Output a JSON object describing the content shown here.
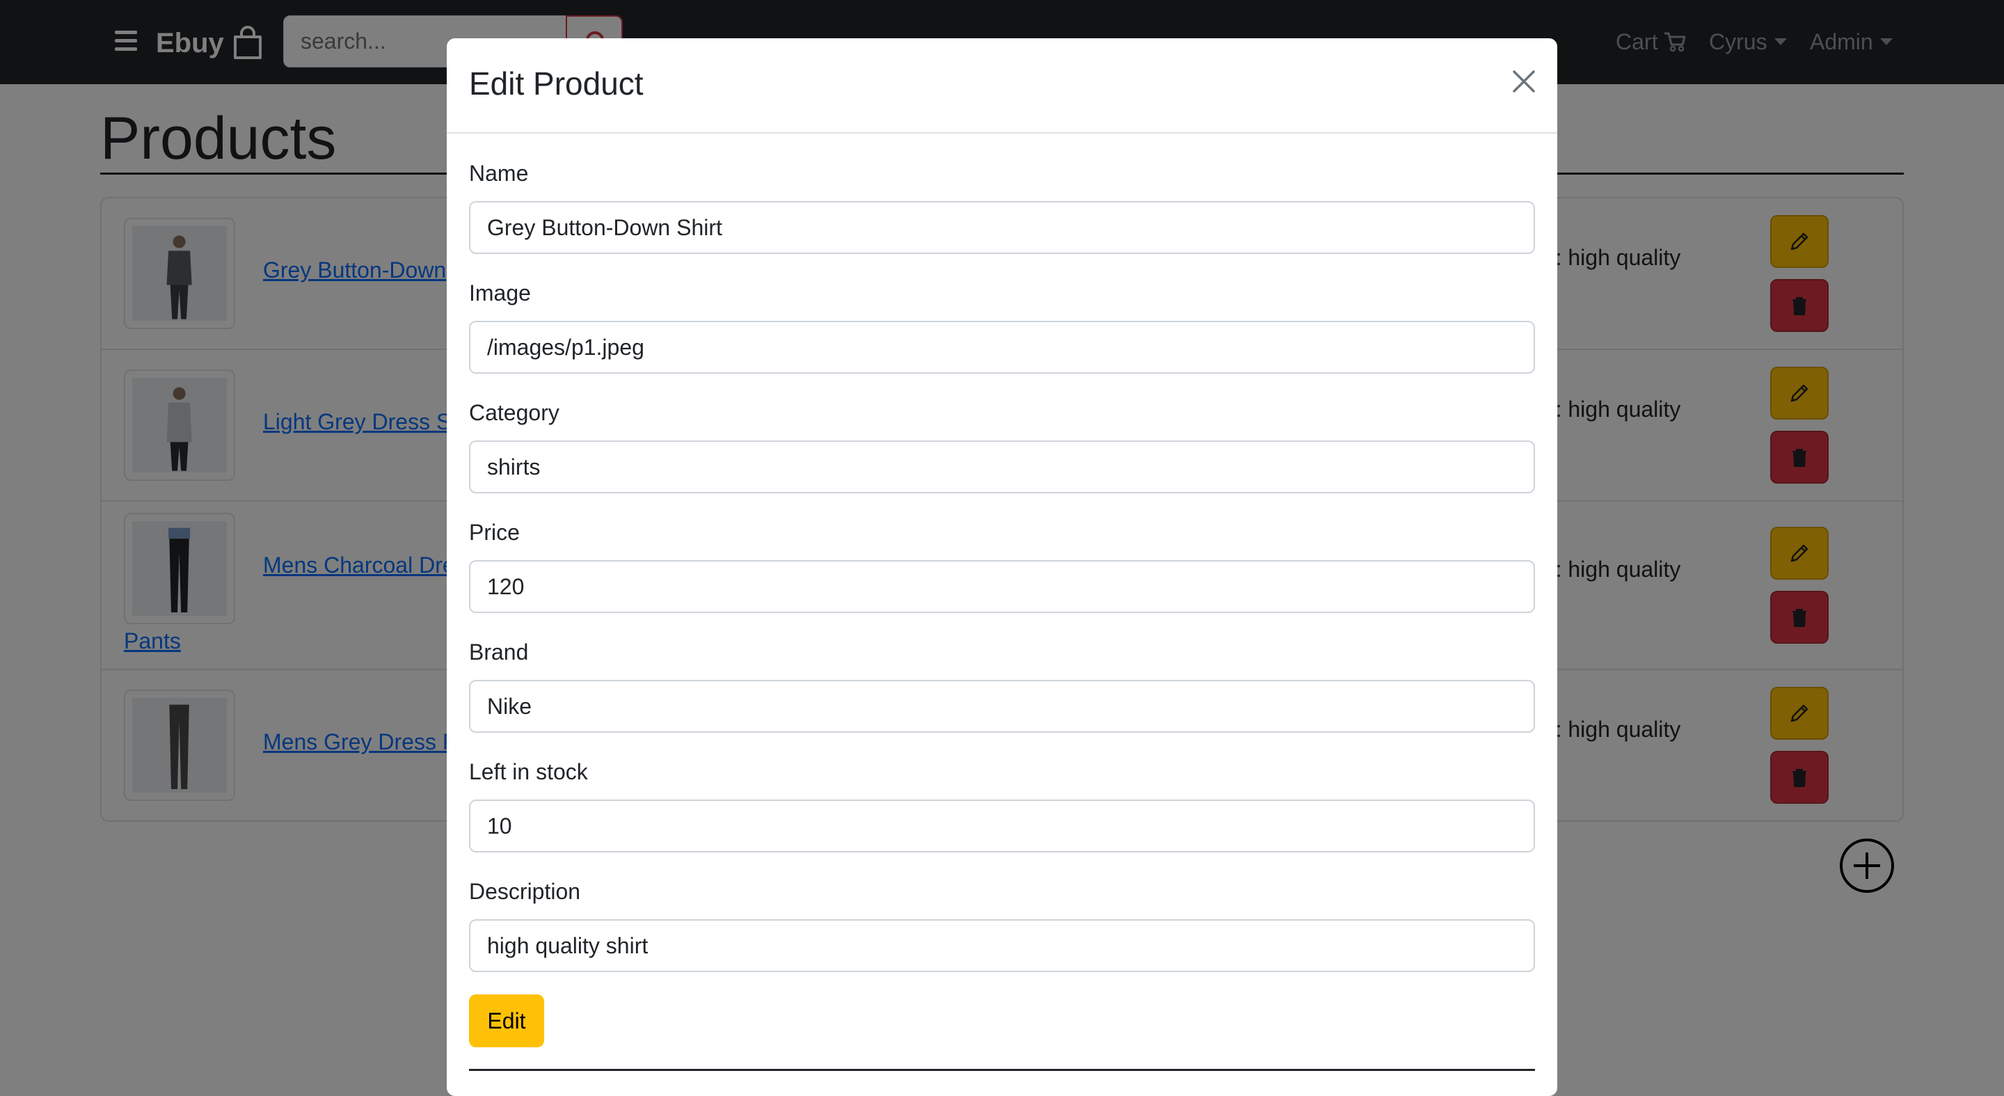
{
  "navbar": {
    "brand": "Ebuy",
    "search_placeholder": "search...",
    "cart_label": "Cart",
    "user_label": "Cyrus",
    "admin_label": "Admin"
  },
  "page": {
    "title": "Products"
  },
  "products": [
    {
      "name": "Grey Button-Down",
      "description": "on: high quality"
    },
    {
      "name": "Light Grey Dress S",
      "description": "on: high quality"
    },
    {
      "name": "Mens Charcoal Dre",
      "name_wrap": "Pants",
      "description": "on: high quality"
    },
    {
      "name": "Mens Grey Dress F",
      "description": "on: high quality"
    }
  ],
  "modal": {
    "title": "Edit Product",
    "fields": [
      {
        "label": "Name",
        "value": "Grey Button-Down Shirt"
      },
      {
        "label": "Image",
        "value": "/images/p1.jpeg"
      },
      {
        "label": "Category",
        "value": "shirts"
      },
      {
        "label": "Price",
        "value": "120"
      },
      {
        "label": "Brand",
        "value": "Nike"
      },
      {
        "label": "Left in stock",
        "value": "10"
      },
      {
        "label": "Description",
        "value": "high quality shirt"
      }
    ],
    "submit_label": "Edit"
  },
  "colors": {
    "navbar": "#212529",
    "warning": "#ffc107",
    "danger": "#dc3545",
    "link": "#0d6efd"
  },
  "icons": {
    "menu": "hamburger-icon",
    "brand": "shopping-bag-icon",
    "search": "search-icon",
    "cart": "cart-icon",
    "edit": "pencil-icon",
    "delete": "trash-icon",
    "add": "plus-circle-icon",
    "close": "close-icon"
  }
}
